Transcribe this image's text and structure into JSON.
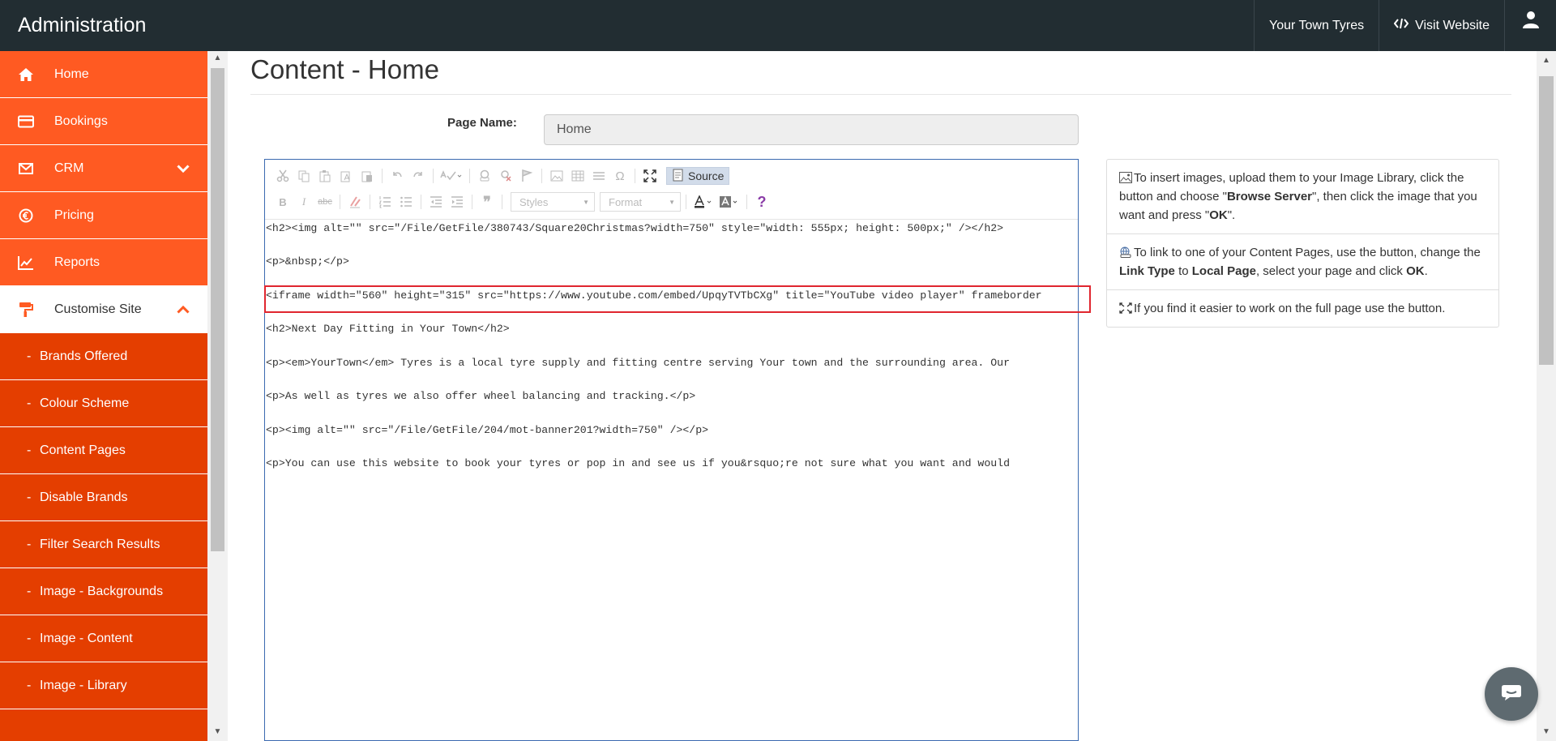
{
  "app": {
    "title": "Administration"
  },
  "topnav": {
    "site_name": "Your Town Tyres",
    "visit_label": "Visit Website",
    "user_icon": "user-icon"
  },
  "sidebar": {
    "items": [
      {
        "label": "Home",
        "icon": "home-icon"
      },
      {
        "label": "Bookings",
        "icon": "credit-card-icon"
      },
      {
        "label": "CRM",
        "icon": "envelope-icon"
      },
      {
        "label": "Pricing",
        "icon": "euro-icon"
      },
      {
        "label": "Reports",
        "icon": "line-chart-icon"
      },
      {
        "label": "Customise Site",
        "icon": "paint-roller-icon"
      }
    ],
    "subitems": [
      "Brands Offered",
      "Colour Scheme",
      "Content Pages",
      "Disable Brands",
      "Filter Search Results",
      "Image - Backgrounds",
      "Image - Content",
      "Image - Library"
    ],
    "dash": "-"
  },
  "page": {
    "title": "Content - Home",
    "page_name_label": "Page Name:",
    "page_name_value": "Home"
  },
  "editor": {
    "source_label": "Source",
    "styles_label": "Styles",
    "format_label": "Format",
    "code_lines": [
      "<h2><img alt=\"\" src=\"/File/GetFile/380743/Square20Christmas?width=750\" style=\"width: 555px; height: 500px;\" /></h2>",
      "<p>&nbsp;</p>",
      "<iframe width=\"560\" height=\"315\" src=\"https://www.youtube.com/embed/UpqyTVTbCXg\" title=\"YouTube video player\" frameborder",
      "<h2>Next Day Fitting in Your Town</h2>",
      "<p><em>YourTown</em> Tyres is a local tyre supply and fitting centre serving Your town and the surrounding area. Our",
      "<p>As well as tyres we also offer wheel balancing and tracking.</p>",
      "<p><img alt=\"\" src=\"/File/GetFile/204/mot-banner201?width=750\" /></p>",
      "<p>You can use this website to book your tyres or pop in and see us if you&rsquo;re not sure what you want and would"
    ]
  },
  "help": {
    "insert_images": {
      "t1": "To insert images, upload them to your Image Library, click the button and choose \"",
      "b1": "Browse Server",
      "t2": "\", then click the image that you want and press \"",
      "b2": "OK",
      "t3": "\"."
    },
    "link_pages": {
      "t1": "To link to one of your Content Pages, use the button, change the ",
      "b1": "Link Type",
      "t2": " to ",
      "b2": "Local Page",
      "t3": ", select your page and click ",
      "b3": "OK",
      "t4": "."
    },
    "full_page": "If you find it easier to work on the full page use the button."
  },
  "colors": {
    "topbar": "#222d32",
    "sidebar_orange": "#ff5a22",
    "sidebar_sub": "#e43e00",
    "highlight": "#e0262f"
  }
}
